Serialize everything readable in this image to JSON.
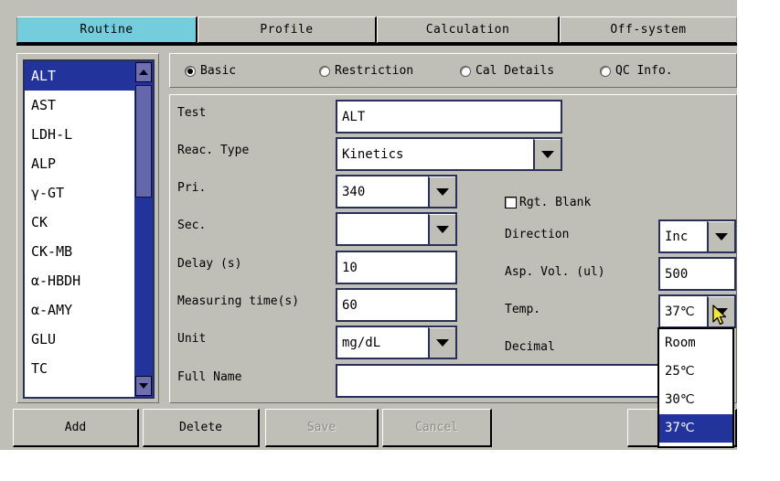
{
  "window": {
    "tabs": [
      {
        "label": "Routine",
        "active": true
      },
      {
        "label": "Profile",
        "active": false
      },
      {
        "label": "Calculation",
        "active": false
      },
      {
        "label": "Off-system",
        "active": false
      }
    ]
  },
  "test_list": {
    "items": [
      {
        "label": "ALT",
        "selected": true
      },
      {
        "label": "AST",
        "selected": false
      },
      {
        "label": "LDH-L",
        "selected": false
      },
      {
        "label": "ALP",
        "selected": false
      },
      {
        "label": "γ-GT",
        "selected": false
      },
      {
        "label": "CK",
        "selected": false
      },
      {
        "label": "CK-MB",
        "selected": false
      },
      {
        "label": "α-HBDH",
        "selected": false
      },
      {
        "label": "α-AMY",
        "selected": false
      },
      {
        "label": "GLU",
        "selected": false
      },
      {
        "label": "TC",
        "selected": false
      }
    ],
    "scroll_up_icon": "triangle-up-icon",
    "scroll_down_icon": "triangle-down-icon"
  },
  "radios": [
    {
      "label": "Basic",
      "selected": true
    },
    {
      "label": "Restriction",
      "selected": false
    },
    {
      "label": "Cal Details",
      "selected": false
    },
    {
      "label": "QC Info.",
      "selected": false
    }
  ],
  "form": {
    "test_label": "Test",
    "test_value": "ALT",
    "reac_type_label": "Reac. Type",
    "reac_type_value": "Kinetics",
    "pri_label": "Pri.",
    "pri_value": "340",
    "sec_label": "Sec.",
    "sec_value": "",
    "delay_label": "Delay (s)",
    "delay_value": "10",
    "measuring_time_label": "Measuring time(s)",
    "measuring_time_value": "60",
    "unit_label": "Unit",
    "unit_value": "mg/dL",
    "full_name_label": "Full Name",
    "full_name_value": "",
    "rgt_blank_label": "Rgt. Blank",
    "rgt_blank_checked": false,
    "direction_label": "Direction",
    "direction_value": "Inc",
    "asp_vol_label": "Asp. Vol. (ul)",
    "asp_vol_value": "500",
    "temp_label": "Temp.",
    "temp_value": "37℃",
    "decimal_label": "Decimal"
  },
  "temp_dropdown": {
    "open": true,
    "options": [
      {
        "label": "Room",
        "selected": false
      },
      {
        "label": "25℃",
        "selected": false
      },
      {
        "label": "30℃",
        "selected": false
      },
      {
        "label": "37℃",
        "selected": true
      }
    ]
  },
  "buttons": [
    {
      "label": "Add",
      "enabled": true
    },
    {
      "label": "Delete",
      "enabled": true
    },
    {
      "label": "Save",
      "enabled": false
    },
    {
      "label": "Cancel",
      "enabled": false
    }
  ],
  "colors": {
    "active_tab": "#74cddd",
    "face": "#bfbfb8",
    "selection": "#22349b",
    "field_border": "#283058",
    "scroll_thumb": "#6567ad"
  }
}
